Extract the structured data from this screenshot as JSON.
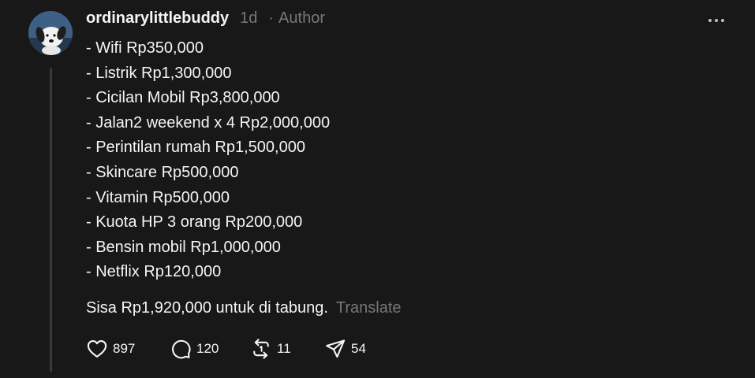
{
  "post": {
    "username": "ordinarylittlebuddy",
    "time": "1d",
    "separator": "·",
    "author_badge": "Author",
    "lines": [
      "- Wifi Rp350,000",
      "- Listrik Rp1,300,000",
      "- Cicilan Mobil Rp3,800,000",
      "- Jalan2 weekend x 4 Rp2,000,000",
      "- Perintilan rumah Rp1,500,000",
      "- Skincare Rp500,000",
      "- Vitamin Rp500,000",
      "- Kuota HP 3 orang Rp200,000",
      "- Bensin mobil Rp1,000,000",
      "- Netflix Rp120,000"
    ],
    "closing": "Sisa Rp1,920,000 untuk di tabung.",
    "translate_label": "Translate"
  },
  "actions": {
    "likes": "897",
    "replies": "120",
    "reposts": "11",
    "shares": "54"
  },
  "icons": {
    "like": "heart-icon",
    "reply": "comment-icon",
    "repost": "repost-icon",
    "share": "send-icon",
    "more": "more-horizontal-icon"
  },
  "colors": {
    "background": "#181818",
    "text": "#f3f5f7",
    "muted": "#777777",
    "thread_line": "#3a3a3a"
  }
}
